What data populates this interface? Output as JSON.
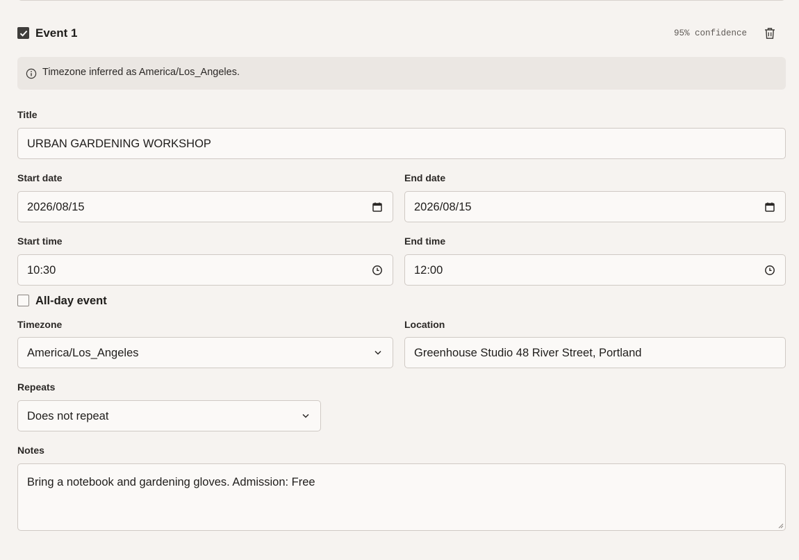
{
  "event": {
    "title": "Event 1",
    "confidence": "95% confidence",
    "checked": true
  },
  "info": {
    "message": "Timezone inferred as America/Los_Angeles."
  },
  "form": {
    "title_label": "Title",
    "title_value": "URBAN GARDENING WORKSHOP",
    "start_date_label": "Start date",
    "start_date_value": "2026/08/15",
    "end_date_label": "End date",
    "end_date_value": "2026/08/15",
    "start_time_label": "Start time",
    "start_time_value": "10:30",
    "end_time_label": "End time",
    "end_time_value": "12:00",
    "all_day_label": "All-day event",
    "all_day_checked": false,
    "timezone_label": "Timezone",
    "timezone_value": "America/Los_Angeles",
    "location_label": "Location",
    "location_value": "Greenhouse Studio 48 River Street, Portland",
    "repeats_label": "Repeats",
    "repeats_value": "Does not repeat",
    "notes_label": "Notes",
    "notes_value": "Bring a notebook and gardening gloves. Admission: Free"
  },
  "icons": {
    "checkbox": "checkbox-checked-icon",
    "delete": "trash-icon",
    "info": "info-icon",
    "date": "calendar-icon",
    "time": "clock-icon",
    "dropdown": "chevron-down-icon"
  }
}
